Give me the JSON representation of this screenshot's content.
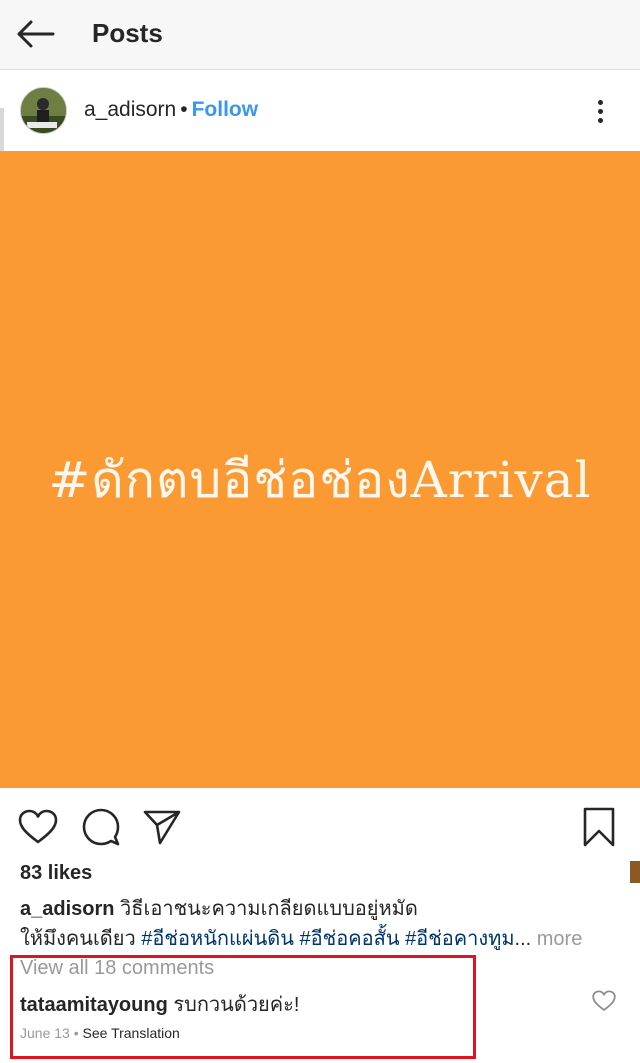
{
  "topbar": {
    "title": "Posts",
    "back_icon": "arrow-left-icon"
  },
  "post": {
    "username": "a_adisorn",
    "separator": "•",
    "follow_label": "Follow",
    "image_text": "#ดักตบอีช่อช่องArrival",
    "image_bg_color": "#fb9a33"
  },
  "actions": {
    "like_icon": "heart-icon",
    "comment_icon": "comment-icon",
    "share_icon": "send-icon",
    "save_icon": "bookmark-icon"
  },
  "likes": "83 likes",
  "caption": {
    "username": "a_adisorn",
    "text_line1": "วิธีเอาชนะความเกลียดแบบอยู่หมัด",
    "text_line2_prefix": "ให้มึงคนเดียว",
    "hashtag1": "#อีช่อหนักแผ่นดิน",
    "hashtag2": "#อีช่อคอสั้น",
    "hashtag3": "#อีช่อคางทูม",
    "ellipsis": "...",
    "more_label": "more"
  },
  "comments": {
    "view_all": "View all 18 comments",
    "items": [
      {
        "username": "tataamitayoung",
        "text": "รบกวนด้วยค่ะ!",
        "date": "June 13",
        "separator": "•",
        "translate": "See Translation"
      }
    ],
    "highlight_color": "#e0141e"
  }
}
